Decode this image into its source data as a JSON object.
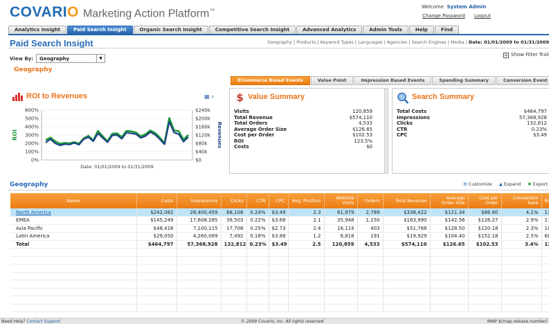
{
  "brand": {
    "logo_left": "COVARI",
    "logo_o": "O",
    "product": "Marketing Action Platform",
    "tm": "™"
  },
  "header": {
    "welcome": "Welcome",
    "user": "System Admin",
    "change_password": "Change Password",
    "logout": "Logout"
  },
  "nav": {
    "tabs": [
      "Analytics Insight",
      "Paid Search Insight",
      "Organic Search Insight",
      "Competitive Search Insight",
      "Advanced Analytics",
      "Admin Tools",
      "Help",
      "Find"
    ],
    "active": "Paid Search Insight"
  },
  "page": {
    "title": "Paid Search Insight",
    "filter_links": "Geography | Products | Keyword Types | Languages | Agencies | Search Engines | Media |",
    "date_range": "Date: 01/01/2009 to 01/31/2009",
    "view_by_label": "View By:",
    "view_by_value": "Geography",
    "show_filter_trail": "Show Filter Trail",
    "breadcrumb": "Geography"
  },
  "insight_tabs": [
    "ECommerce Based Events",
    "Value Point",
    "Impression Based Events",
    "Spending Summary",
    "Conversion Event Details"
  ],
  "roi_panel": {
    "title": "ROI to Revenues",
    "ylabel_left": "ROI",
    "ylabel_right": "Revenues",
    "date_caption": "Date: 01/01/2009 to 01/31/2009"
  },
  "value_summary": {
    "title": "Value Summary",
    "rows": [
      {
        "label": "Visits",
        "value": "120,859"
      },
      {
        "label": "Total Revenue",
        "value": "$574,110"
      },
      {
        "label": "Total Orders",
        "value": "4,533"
      },
      {
        "label": "Average Order Size",
        "value": "$126.65"
      },
      {
        "label": "Cost per Order",
        "value": "$102.53"
      },
      {
        "label": "ROI",
        "value": "123.5%"
      },
      {
        "label": "Costs",
        "value": "$0"
      }
    ]
  },
  "search_summary": {
    "title": "Search Summary",
    "rows": [
      {
        "label": "Total Costs",
        "value": "$464,797"
      },
      {
        "label": "Impressions",
        "value": "57,368,928"
      },
      {
        "label": "Clicks",
        "value": "132,812"
      },
      {
        "label": "CTR",
        "value": "0.23%"
      },
      {
        "label": "CPC",
        "value": "$3.49"
      }
    ]
  },
  "grid": {
    "title": "Geography",
    "actions": [
      "Customize",
      "Expand",
      "Export"
    ],
    "columns": [
      "Name",
      "Costs",
      "Impressions",
      "Clicks",
      "CTR",
      "CPC",
      "Avg. Position",
      "Website Visits",
      "Orders",
      "Total Revenue",
      "Average Order Size",
      "Cost per Order",
      "Conversion Rate",
      "ROI"
    ],
    "rows": [
      [
        "North America",
        "$242,082",
        "28,400,459",
        "68,108",
        "0.24%",
        "$3.49",
        "2.3",
        "61,979",
        "2,789",
        "$338,422",
        "$121.34",
        "$86.80",
        "4.1%",
        "139.8%"
      ],
      [
        "EMEA",
        "$145,249",
        "17,608.285",
        "39,503",
        "0.22%",
        "$3.68",
        "2.1",
        "35,948",
        "1,150",
        "$163,990",
        "$142.56",
        "$126.27",
        "2.9%",
        "112.9%"
      ],
      [
        "Asia Pacific",
        "$48,416",
        "7,100,115",
        "17,708",
        "0.25%",
        "$2.73",
        "2.4",
        "16,114",
        "403",
        "$51,768",
        "$128.50",
        "$120.18",
        "2.3%",
        "106.9%"
      ],
      [
        "Latin America",
        "$29,050",
        "4,260,069",
        "7,492",
        "0.18%",
        "$3.88",
        "1.2",
        "6,818",
        "191",
        "$19,929",
        "$104.40",
        "$152.18",
        "2.5%",
        "68.6%"
      ],
      [
        "Total",
        "$464,797",
        "57,368,928",
        "132,812",
        "0.23%",
        "$3.49",
        "2.5",
        "120,859",
        "4,533",
        "$574,110",
        "$126.65",
        "$102.53",
        "3.4%",
        "123.5%"
      ]
    ]
  },
  "footer": {
    "need_help": "Need Help?",
    "contact": "Contact Support",
    "copyright": "© 2009 Covario, Inc. All rights reserved",
    "imap": "IMAP $(map.release.number)"
  },
  "colors": {
    "brand_blue": "#1f6cb5",
    "accent_orange": "#ec7d14",
    "selected_row": "#bfe4f7",
    "series_roi": "#1f9a3a",
    "series_revenue": "#1c3f86"
  },
  "chart_data": {
    "type": "line",
    "title": "ROI to Revenues",
    "xlabel": "Date: 01/01/2009 to 01/31/2009",
    "ylabel": "ROI",
    "ylabel_right": "Revenues",
    "y_ticks": [
      "0%",
      "100%",
      "200%",
      "300%",
      "400%",
      "500%",
      "600%"
    ],
    "y2_ticks": [
      "$0",
      "$40k",
      "$80k",
      "$120k",
      "$160k",
      "$200k",
      "$240k"
    ],
    "ylim": [
      0,
      600
    ],
    "y2lim": [
      0,
      240000
    ],
    "x": [
      1,
      2,
      3,
      4,
      5,
      6,
      7,
      8,
      9,
      10,
      11,
      12,
      13,
      14,
      15,
      16,
      17,
      18,
      19,
      20,
      21,
      22,
      23,
      24,
      25,
      26,
      27,
      28,
      29,
      30,
      31
    ],
    "series": [
      {
        "axis": "left",
        "values": [
          240,
          270,
          225,
          195,
          205,
          200,
          215,
          195,
          260,
          290,
          235,
          350,
          285,
          225,
          315,
          320,
          275,
          350,
          345,
          330,
          285,
          310,
          355,
          325,
          270,
          200,
          505,
          355,
          345,
          245,
          300
        ]
      },
      {
        "axis": "right",
        "values": [
          84000,
          100000,
          80000,
          70000,
          76000,
          74000,
          82000,
          73000,
          100000,
          110000,
          90000,
          128000,
          106000,
          85000,
          118000,
          120000,
          102000,
          132000,
          128000,
          124000,
          106000,
          115000,
          134000,
          122000,
          100000,
          75000,
          184000,
          132000,
          124000,
          88000,
          110000
        ]
      }
    ]
  }
}
